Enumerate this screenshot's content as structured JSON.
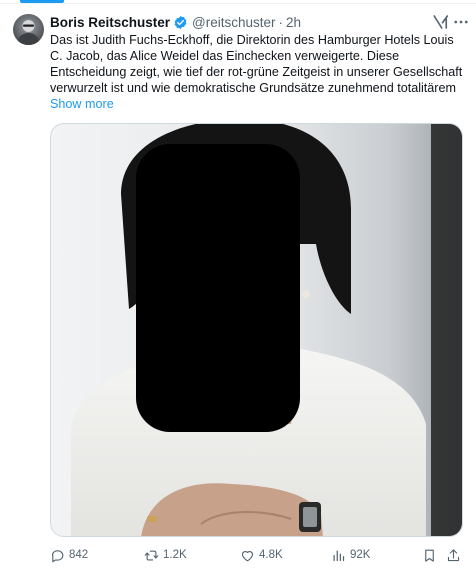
{
  "tweet": {
    "author_name": "Boris Reitschuster",
    "handle": "@reitschuster",
    "separator": "·",
    "time": "2h",
    "text": "Das ist Judith Fuchs-Eckhoff, die Direktorin des Hamburger Hotels Louis C. Jacob, das Alice Weidel das Einchecken verweigerte. Diese Entscheidung zeigt, wie tief der rot-grüne Zeitgeist in unserer Gesellschaft verwurzelt ist und wie demokratische Grundsätze zunehmend totalitärem",
    "show_more": "Show more"
  },
  "actions": {
    "replies": "842",
    "reposts": "1.2K",
    "likes": "4.8K",
    "views": "92K"
  },
  "colors": {
    "accent": "#1d9bf0",
    "muted": "#536471",
    "text": "#0f1419"
  },
  "icons": [
    "verified-badge-icon",
    "grok-icon",
    "more-icon",
    "reply-icon",
    "repost-icon",
    "like-icon",
    "views-icon",
    "bookmark-icon",
    "share-icon"
  ]
}
